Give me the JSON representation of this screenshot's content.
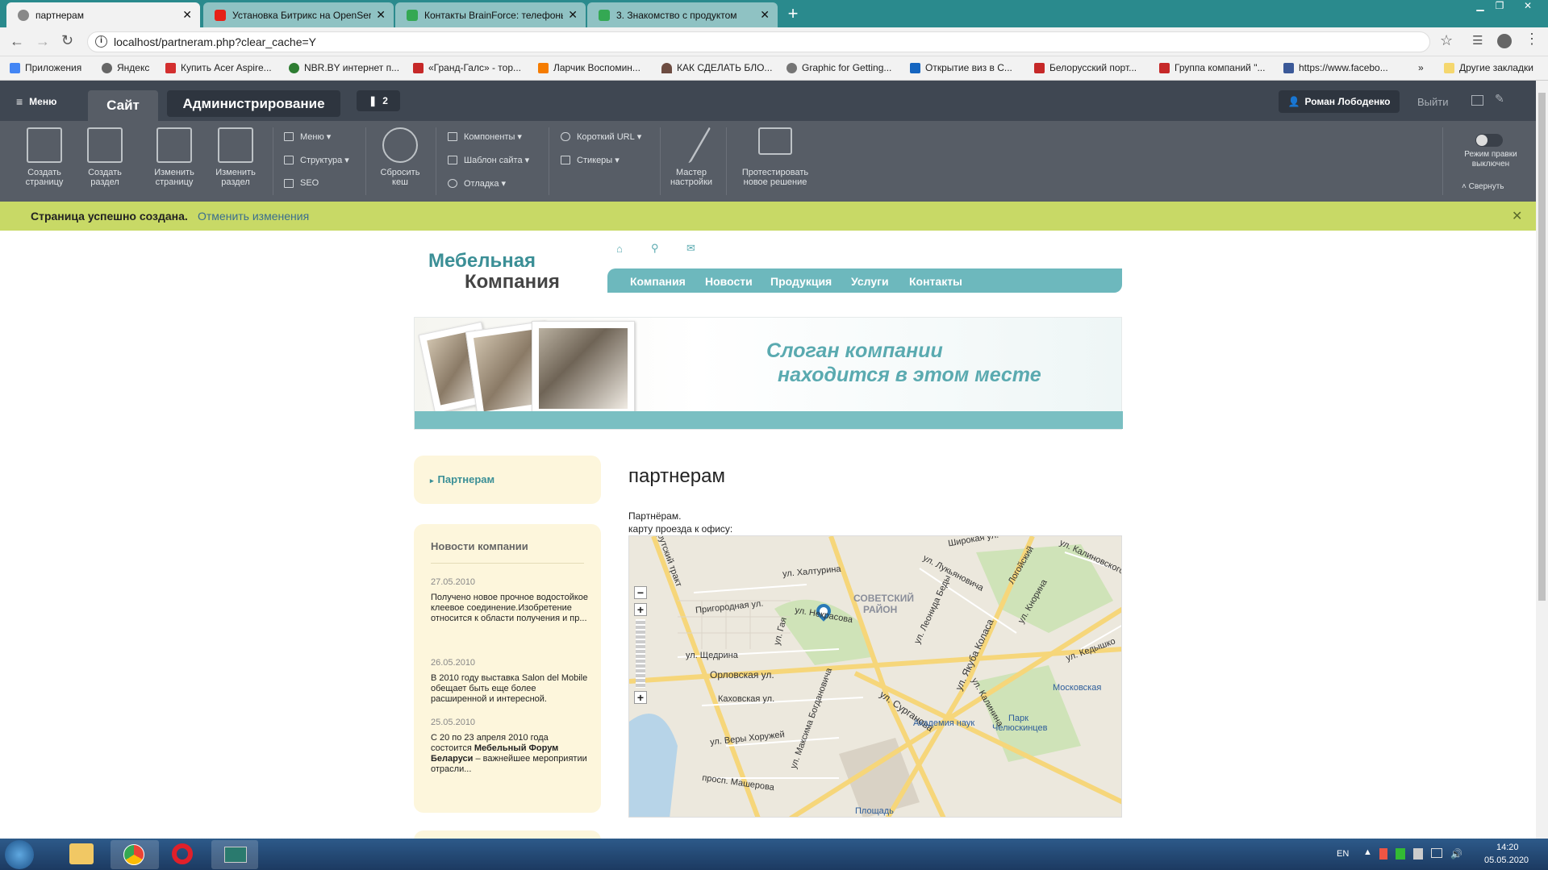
{
  "browser": {
    "tabs": [
      {
        "title": "партнерам",
        "icon_color": "#888888",
        "active": true
      },
      {
        "title": "Установка Битрикс на OpenServ",
        "icon_color": "#e62117",
        "active": false
      },
      {
        "title": "Контакты BrainForce: телефоны",
        "icon_color": "#34a853",
        "active": false
      },
      {
        "title": "3. Знакомство с продуктом",
        "icon_color": "#34a853",
        "active": false
      }
    ],
    "close_glyph": "✕",
    "newtab_glyph": "+",
    "url": "localhost/partneram.php?clear_cache=Y",
    "bookmarks": [
      {
        "label": "Приложения",
        "icon_color": "#4285f4"
      },
      {
        "label": "Яндекс",
        "icon_color": "#666666"
      },
      {
        "label": "Купить Acer Aspire...",
        "icon_color": "#d32f2f"
      },
      {
        "label": "NBR.BY интернет п...",
        "icon_color": "#2e7d32"
      },
      {
        "label": "«Гранд-Галс» - тор...",
        "icon_color": "#c62828"
      },
      {
        "label": "Ларчик Воспомин...",
        "icon_color": "#f57c00"
      },
      {
        "label": "КАК СДЕЛАТЬ БЛО...",
        "icon_color": "#6d4c41"
      },
      {
        "label": "Graphic for Getting...",
        "icon_color": "#757575"
      },
      {
        "label": "Открытие виз в С...",
        "icon_color": "#1565c0"
      },
      {
        "label": "Белорусский порт...",
        "icon_color": "#c62828"
      },
      {
        "label": "Группа компаний \"...",
        "icon_color": "#c62828"
      },
      {
        "label": "https://www.facebo...",
        "icon_color": "#3b5998"
      }
    ],
    "bookmarks_more": "»",
    "other_bookmarks": "Другие закладки"
  },
  "bitrix": {
    "menu": "Меню",
    "tab_site": "Сайт",
    "tab_admin": "Администрирование",
    "notifications": "2",
    "user": "Роман Лободенко",
    "logout": "Выйти",
    "toolbar": {
      "create_page": [
        "Создать",
        "страницу"
      ],
      "create_section": [
        "Создать",
        "раздел"
      ],
      "edit_page": [
        "Изменить",
        "страницу"
      ],
      "edit_section": [
        "Изменить",
        "раздел"
      ],
      "menu": "Меню",
      "structure": "Структура",
      "seo": "SEO",
      "reset_cache": [
        "Сбросить",
        "кеш"
      ],
      "components": "Компоненты",
      "site_template": "Шаблон сайта",
      "debug": "Отладка",
      "short_url": "Короткий URL",
      "stickers": "Стикеры",
      "wizard": [
        "Мастер",
        "настройки"
      ],
      "test_solution": [
        "Протестировать",
        "новое решение"
      ],
      "edit_mode": [
        "Режим правки",
        "выключен"
      ],
      "collapse": "Свернуть"
    },
    "notice": "Страница успешно создана.",
    "notice_undo": "Отменить изменения"
  },
  "site": {
    "logo_line1": "Мебельная",
    "logo_line2": "Компания",
    "nav": [
      "Компания",
      "Новости",
      "Продукция",
      "Услуги",
      "Контакты"
    ],
    "slogan_line1": "Слоган компании",
    "slogan_line2": "находится в этом месте",
    "left_menu_item": "Партнерам",
    "news_title": "Новости компании",
    "news": [
      {
        "date": "27.05.2010",
        "text": "Получено новое прочное водостойкое клеевое соединение.Изобретение относится к области получения и пр..."
      },
      {
        "date": "26.05.2010",
        "text": "В 2010 году выставка Salon del Mobile обещает быть еще более расширенной и интересной."
      },
      {
        "date": "25.05.2010",
        "text_before": "С 20 по 23 апреля 2010 года состоится ",
        "text_bold": "Мебельный Форум Беларуси",
        "text_after": " – важнейшее мероприятии отрасли..."
      }
    ],
    "page_title": "партнерам",
    "body_line1": "Партнёрам.",
    "body_line2": "карту проезда к офису:",
    "map": {
      "zoom_in": "+",
      "zoom_out": "−",
      "labels": [
        "ул. Халтурина",
        "ул. Лукьяновича",
        "Логойский",
        "ул. Калиновского",
        "СОВЕТСКИЙ",
        "РАЙОН",
        "Пригородная ул.",
        "ул. Некрасова",
        "ул. Щедрина",
        "Орловская ул.",
        "Каховская ул.",
        "ул. Веры Хоружей",
        "ул. Сурганова",
        "ул. Якуба Коласа",
        "Академия наук",
        "Парк",
        "Челюскинцев",
        "Московская",
        "просп. Машерова",
        "Площадь",
        "ул. Кедышко",
        "ул. Гая",
        "ул. Леонида Беды",
        "ул. Максима Богдановича",
        "ул. Калинина",
        "ул. Кнорина",
        "Широкая ул.",
        "Ирутский тракт"
      ]
    }
  },
  "taskbar": {
    "lang": "EN",
    "time": "14:20",
    "date": "05.05.2020"
  }
}
